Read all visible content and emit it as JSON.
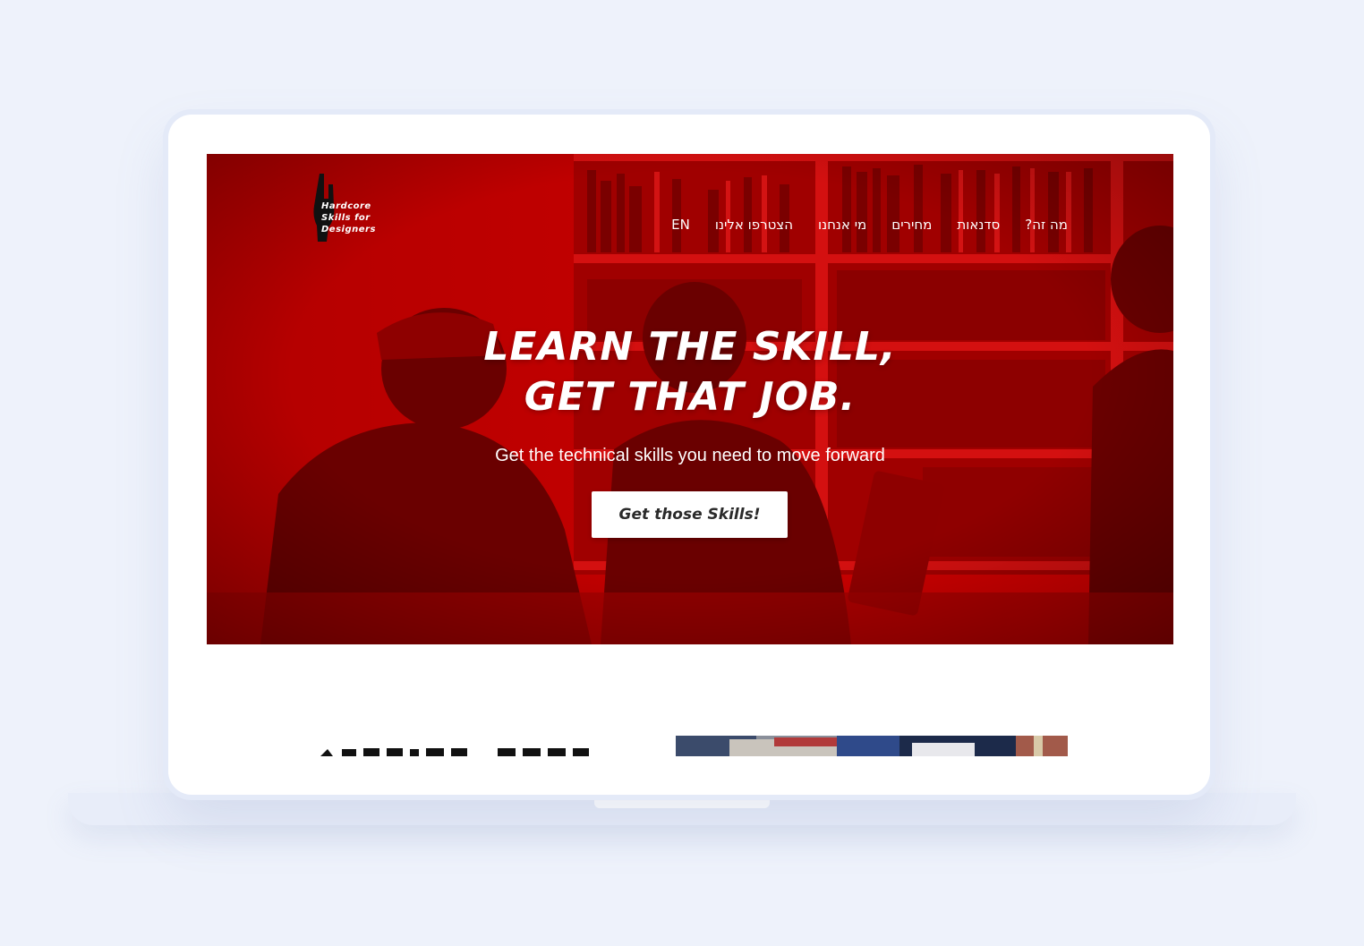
{
  "logo": {
    "lines": [
      "Hardcore",
      "Skills for",
      "Designers"
    ]
  },
  "nav": {
    "items": [
      {
        "label": "מה זה?",
        "name": "nav-item-what-is-it"
      },
      {
        "label": "סדנאות",
        "name": "nav-item-workshops"
      },
      {
        "label": "מחירים",
        "name": "nav-item-prices"
      },
      {
        "label": "מי אנחנו",
        "name": "nav-item-about"
      },
      {
        "label": "הצטרפו אלינו",
        "name": "nav-item-join"
      },
      {
        "label": "EN",
        "name": "nav-item-language"
      }
    ]
  },
  "hero": {
    "headline_line1": "Learn the skill,",
    "headline_line2": "get that job.",
    "subtitle": "Get the technical skills you need to move forward",
    "cta_label": "Get those Skills!"
  },
  "colors": {
    "hero_red": "#c80000",
    "page_background": "#eef2fb",
    "screen_background": "#ffffff"
  }
}
